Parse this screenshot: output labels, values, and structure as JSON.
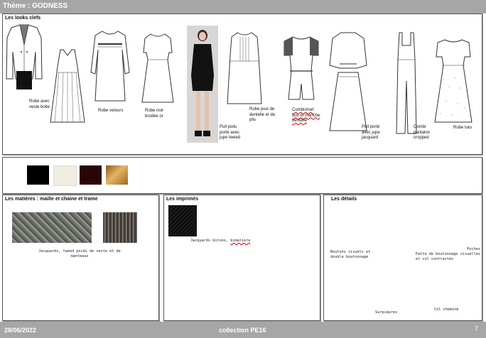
{
  "header": {
    "title": "Thème : GODNESS"
  },
  "looks": {
    "title": "Les looks clefs",
    "items": [
      {
        "label": "Robe avec veste boite"
      },
      {
        "label": "Robe velours"
      },
      {
        "label": "Robe noir brodée or"
      },
      {
        "label": "Pull poilu porté avec jupe tweed"
      },
      {
        "label": "Robe jeux de dentelle et de plis"
      },
      {
        "label": "Combishort dos et manche dentelle"
      },
      {
        "label": "Pull porté avec jupe jacquard"
      },
      {
        "label": "Combi pantalon cropped"
      },
      {
        "label": "Robe tutu"
      }
    ]
  },
  "colors": {
    "swatches": [
      "#000000",
      "#f0ece0",
      "#2a0505",
      "#b8863a"
    ]
  },
  "matieres": {
    "title": "Les matières : maille et chaine et trame",
    "caption": "Jacquards, tweed poids de veste et de manteaux"
  },
  "imprimes": {
    "title": "Les imprimés",
    "caption_start": "Jacquards bitons, ",
    "caption_flagged": "bimatière"
  },
  "details": {
    "title": "Les détails",
    "items": [
      {
        "label": "Boutons visuels et double boutonnage"
      },
      {
        "label": "Patte de boutonnage et col contrastés"
      },
      {
        "label": "Poches visuelles"
      },
      {
        "label": "Surpiqures"
      },
      {
        "label": "Col cheminé"
      }
    ]
  },
  "footer": {
    "date": "28/06/2022",
    "collection": "collection PE16",
    "page": "7"
  }
}
